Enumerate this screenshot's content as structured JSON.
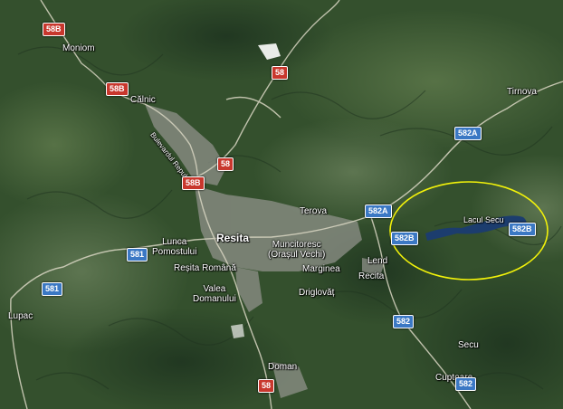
{
  "map": {
    "places": {
      "moniom": "Moniom",
      "calnic": "Călnic",
      "bulevardul": "Bulevardul Republicii",
      "tirnova": "Tirnova",
      "terova": "Terova",
      "resita": "Resita",
      "lunca": "Lunca\nPomostului",
      "muncitoresc": "Muncitoresc\n(Orașul Vechi)",
      "lend": "Lend",
      "resita_romana": "Reșita Română",
      "marginea": "Marginea",
      "recita": "Recita",
      "valea": "Valea\nDomanului",
      "driglovat": "Driglovăț",
      "lupac": "Lupac",
      "lacul_secu": "Lacul Secu",
      "secu": "Secu",
      "cuptoare": "Cuptoare",
      "doman": "Doman"
    },
    "road_shields": {
      "r58b_1": "58B",
      "r58b_2": "58B",
      "r58b_3": "58B",
      "r58_1": "58",
      "r58_2": "58",
      "r58_3": "58",
      "r582a_1": "582A",
      "r582a_2": "582A",
      "r582b_1": "582B",
      "r582b_2": "582B",
      "r581_1": "581",
      "r581_2": "581",
      "r582_1": "582",
      "r582_2": "582"
    },
    "colors": {
      "national_road_shield": "#c8372d",
      "county_road_shield": "#3b78c4",
      "highlight_ellipse": "#f2f20a",
      "forest": "#2f4a2a",
      "urban": "#9a9a92",
      "lake": "#1c3d6e"
    }
  }
}
